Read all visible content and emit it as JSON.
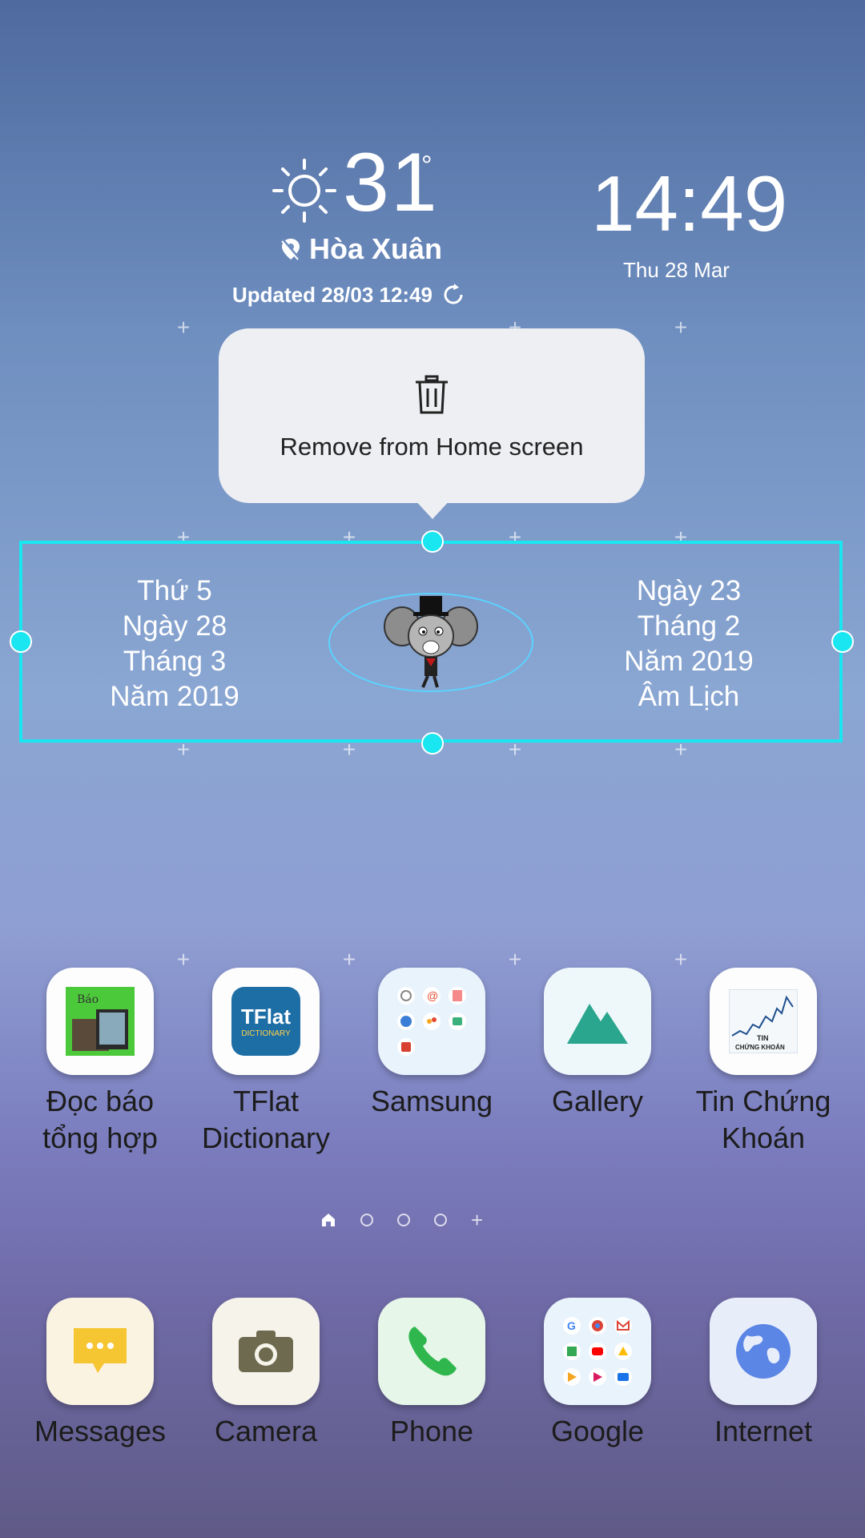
{
  "weather": {
    "temperature": "31",
    "degree_symbol": "°",
    "location": "Hòa Xuân",
    "updated": "Updated 28/03 12:49"
  },
  "clock": {
    "time": "14:49",
    "date": "Thu 28 Mar"
  },
  "popup": {
    "action_label": "Remove from Home screen"
  },
  "calendar_widget": {
    "solar": [
      "Thứ 5",
      "Ngày 28",
      "Tháng 3",
      "Năm 2019"
    ],
    "lunar": [
      "Ngày 23",
      "Tháng 2",
      "Năm 2019",
      "Âm Lịch"
    ]
  },
  "apps": [
    {
      "label_line1": "Đọc báo",
      "label_line2": "tổng hợp",
      "icon": "news-icon"
    },
    {
      "label_line1": "TFlat",
      "label_line2": "Dictionary",
      "icon": "tflat-icon",
      "icon_text": "TFlat",
      "icon_subtext": "DICTIONARY"
    },
    {
      "label_line1": "Samsung",
      "label_line2": "",
      "icon": "folder-icon"
    },
    {
      "label_line1": "Gallery",
      "label_line2": "",
      "icon": "gallery-icon"
    },
    {
      "label_line1": "Tin Chứng",
      "label_line2": "Khoán",
      "icon": "stock-chart-icon",
      "icon_text": "TIN",
      "icon_subtext": "CHỨNG KHOÁN"
    }
  ],
  "dock": [
    {
      "label": "Messages",
      "icon": "messages-icon"
    },
    {
      "label": "Camera",
      "icon": "camera-icon"
    },
    {
      "label": "Phone",
      "icon": "phone-icon"
    },
    {
      "label": "Google",
      "icon": "folder-icon"
    },
    {
      "label": "Internet",
      "icon": "globe-icon"
    }
  ],
  "page_indicator": {
    "pages": 4,
    "current": 0
  },
  "colors": {
    "selection": "#19e6f0"
  }
}
